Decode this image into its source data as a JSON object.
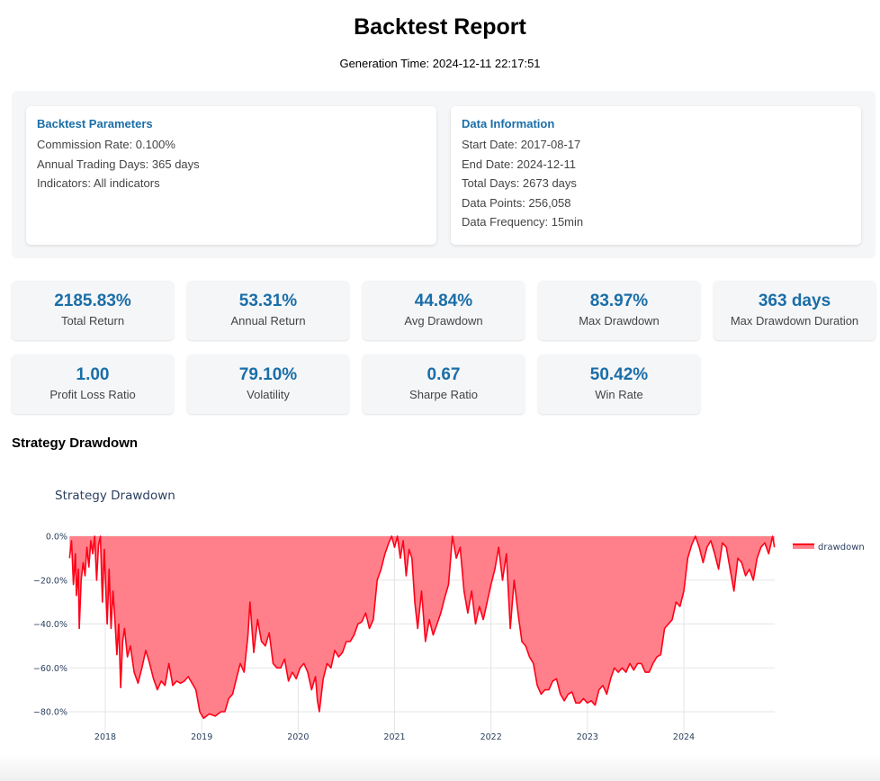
{
  "header": {
    "title": "Backtest Report",
    "generation_time": "Generation Time: 2024-12-11 22:17:51"
  },
  "params_card": {
    "title": "Backtest Parameters",
    "lines": [
      "Commission Rate: 0.100%",
      "Annual Trading Days: 365 days",
      "Indicators: All indicators"
    ]
  },
  "data_card": {
    "title": "Data Information",
    "lines": [
      "Start Date: 2017-08-17",
      "End Date: 2024-12-11",
      "Total Days: 2673 days",
      "Data Points: 256,058",
      "Data Frequency: 15min"
    ]
  },
  "metrics": [
    {
      "value": "2185.83%",
      "label": "Total Return"
    },
    {
      "value": "53.31%",
      "label": "Annual Return"
    },
    {
      "value": "44.84%",
      "label": "Avg Drawdown"
    },
    {
      "value": "83.97%",
      "label": "Max Drawdown"
    },
    {
      "value": "363 days",
      "label": "Max Drawdown Duration"
    },
    {
      "value": "1.00",
      "label": "Profit Loss Ratio"
    },
    {
      "value": "79.10%",
      "label": "Volatility"
    },
    {
      "value": "0.67",
      "label": "Sharpe Ratio"
    },
    {
      "value": "50.42%",
      "label": "Win Rate"
    }
  ],
  "section_title": "Strategy Drawdown",
  "colors": {
    "accent": "#1a6ea8",
    "line": "#ff0018",
    "fill": "#ff808a"
  },
  "chart_data": {
    "type": "area",
    "title": "Strategy Drawdown",
    "xlabel": "",
    "ylabel": "",
    "ylim": [
      -87,
      0
    ],
    "xlim": [
      2017.63,
      2024.94
    ],
    "yticks": [
      0,
      -20,
      -40,
      -60,
      -80
    ],
    "ytick_labels": [
      "0.0%",
      "−20.0%",
      "−40.0%",
      "−60.0%",
      "−80.0%"
    ],
    "xticks": [
      2018,
      2019,
      2020,
      2021,
      2022,
      2023,
      2024
    ],
    "xtick_labels": [
      "2018",
      "2019",
      "2020",
      "2021",
      "2022",
      "2023",
      "2024"
    ],
    "grid": true,
    "legend": {
      "position": "top-right",
      "entries": [
        "drawdown"
      ]
    },
    "series": [
      {
        "name": "drawdown",
        "x": [
          2017.63,
          2017.65,
          2017.67,
          2017.69,
          2017.7,
          2017.72,
          2017.73,
          2017.75,
          2017.77,
          2017.79,
          2017.81,
          2017.83,
          2017.85,
          2017.87,
          2017.89,
          2017.91,
          2017.93,
          2017.95,
          2017.97,
          2017.99,
          2018.02,
          2018.04,
          2018.06,
          2018.08,
          2018.1,
          2018.12,
          2018.14,
          2018.16,
          2018.18,
          2018.2,
          2018.23,
          2018.26,
          2018.3,
          2018.34,
          2018.38,
          2018.42,
          2018.46,
          2018.5,
          2018.54,
          2018.58,
          2018.62,
          2018.66,
          2018.7,
          2018.74,
          2018.78,
          2018.82,
          2018.86,
          2018.9,
          2018.94,
          2018.98,
          2019.02,
          2019.08,
          2019.14,
          2019.2,
          2019.24,
          2019.28,
          2019.32,
          2019.36,
          2019.4,
          2019.44,
          2019.48,
          2019.5,
          2019.54,
          2019.58,
          2019.62,
          2019.66,
          2019.7,
          2019.74,
          2019.78,
          2019.82,
          2019.86,
          2019.9,
          2019.94,
          2019.98,
          2020.02,
          2020.06,
          2020.1,
          2020.14,
          2020.18,
          2020.2,
          2020.22,
          2020.26,
          2020.3,
          2020.34,
          2020.38,
          2020.42,
          2020.46,
          2020.5,
          2020.54,
          2020.58,
          2020.62,
          2020.66,
          2020.7,
          2020.74,
          2020.78,
          2020.82,
          2020.86,
          2020.9,
          2020.94,
          2020.97,
          2021.0,
          2021.03,
          2021.06,
          2021.09,
          2021.12,
          2021.15,
          2021.18,
          2021.21,
          2021.24,
          2021.28,
          2021.32,
          2021.36,
          2021.4,
          2021.44,
          2021.48,
          2021.52,
          2021.56,
          2021.6,
          2021.64,
          2021.68,
          2021.72,
          2021.76,
          2021.8,
          2021.84,
          2021.88,
          2021.92,
          2021.96,
          2022.0,
          2022.04,
          2022.08,
          2022.12,
          2022.16,
          2022.2,
          2022.24,
          2022.28,
          2022.32,
          2022.36,
          2022.4,
          2022.44,
          2022.48,
          2022.52,
          2022.56,
          2022.6,
          2022.64,
          2022.68,
          2022.72,
          2022.76,
          2022.8,
          2022.84,
          2022.88,
          2022.92,
          2022.96,
          2023.0,
          2023.04,
          2023.08,
          2023.12,
          2023.16,
          2023.2,
          2023.24,
          2023.28,
          2023.32,
          2023.36,
          2023.4,
          2023.44,
          2023.48,
          2023.52,
          2023.56,
          2023.6,
          2023.64,
          2023.68,
          2023.72,
          2023.76,
          2023.8,
          2023.84,
          2023.88,
          2023.92,
          2023.96,
          2024.0,
          2024.04,
          2024.08,
          2024.12,
          2024.16,
          2024.2,
          2024.24,
          2024.28,
          2024.32,
          2024.36,
          2024.4,
          2024.44,
          2024.48,
          2024.52,
          2024.56,
          2024.6,
          2024.64,
          2024.68,
          2024.72,
          2024.76,
          2024.8,
          2024.84,
          2024.88,
          2024.92,
          2024.94
        ],
        "y": [
          -10,
          -2,
          -22,
          -8,
          -27,
          -15,
          -42,
          -20,
          -12,
          -18,
          -5,
          -14,
          -2,
          -8,
          0,
          -20,
          -4,
          0,
          -30,
          -6,
          -40,
          -15,
          -42,
          -25,
          -38,
          -54,
          -40,
          -69,
          -48,
          -42,
          -55,
          -50,
          -62,
          -67,
          -60,
          -52,
          -58,
          -65,
          -70,
          -66,
          -68,
          -58,
          -68,
          -66,
          -67,
          -66,
          -64,
          -67,
          -70,
          -80,
          -83,
          -81,
          -82,
          -80,
          -80,
          -74,
          -72,
          -65,
          -58,
          -62,
          -45,
          -30,
          -53,
          -38,
          -48,
          -50,
          -44,
          -58,
          -60,
          -60,
          -56,
          -66,
          -62,
          -65,
          -60,
          -58,
          -62,
          -70,
          -64,
          -75,
          -80,
          -65,
          -58,
          -60,
          -52,
          -55,
          -53,
          -48,
          -48,
          -45,
          -40,
          -39,
          -35,
          -42,
          -38,
          -20,
          -15,
          -8,
          -3,
          0,
          -5,
          0,
          -10,
          -2,
          -18,
          -6,
          -10,
          -30,
          -42,
          -25,
          -48,
          -38,
          -45,
          -40,
          -35,
          -28,
          -22,
          0,
          -10,
          -5,
          -25,
          -35,
          -25,
          -40,
          -32,
          -38,
          -30,
          -22,
          -15,
          -5,
          -20,
          -8,
          -42,
          -20,
          -35,
          -48,
          -50,
          -55,
          -58,
          -68,
          -72,
          -70,
          -70,
          -66,
          -65,
          -72,
          -75,
          -72,
          -71,
          -76,
          -76,
          -74,
          -76,
          -75,
          -77,
          -70,
          -68,
          -72,
          -65,
          -60,
          -62,
          -60,
          -62,
          -58,
          -61,
          -58,
          -58,
          -62,
          -62,
          -58,
          -55,
          -54,
          -42,
          -40,
          -38,
          -30,
          -32,
          -25,
          -10,
          -4,
          0,
          -5,
          -12,
          -5,
          -2,
          -8,
          -15,
          -3,
          -5,
          -15,
          -25,
          -10,
          -12,
          -18,
          -15,
          -20,
          -10,
          -5,
          -3,
          -8,
          0,
          -5
        ]
      }
    ]
  }
}
